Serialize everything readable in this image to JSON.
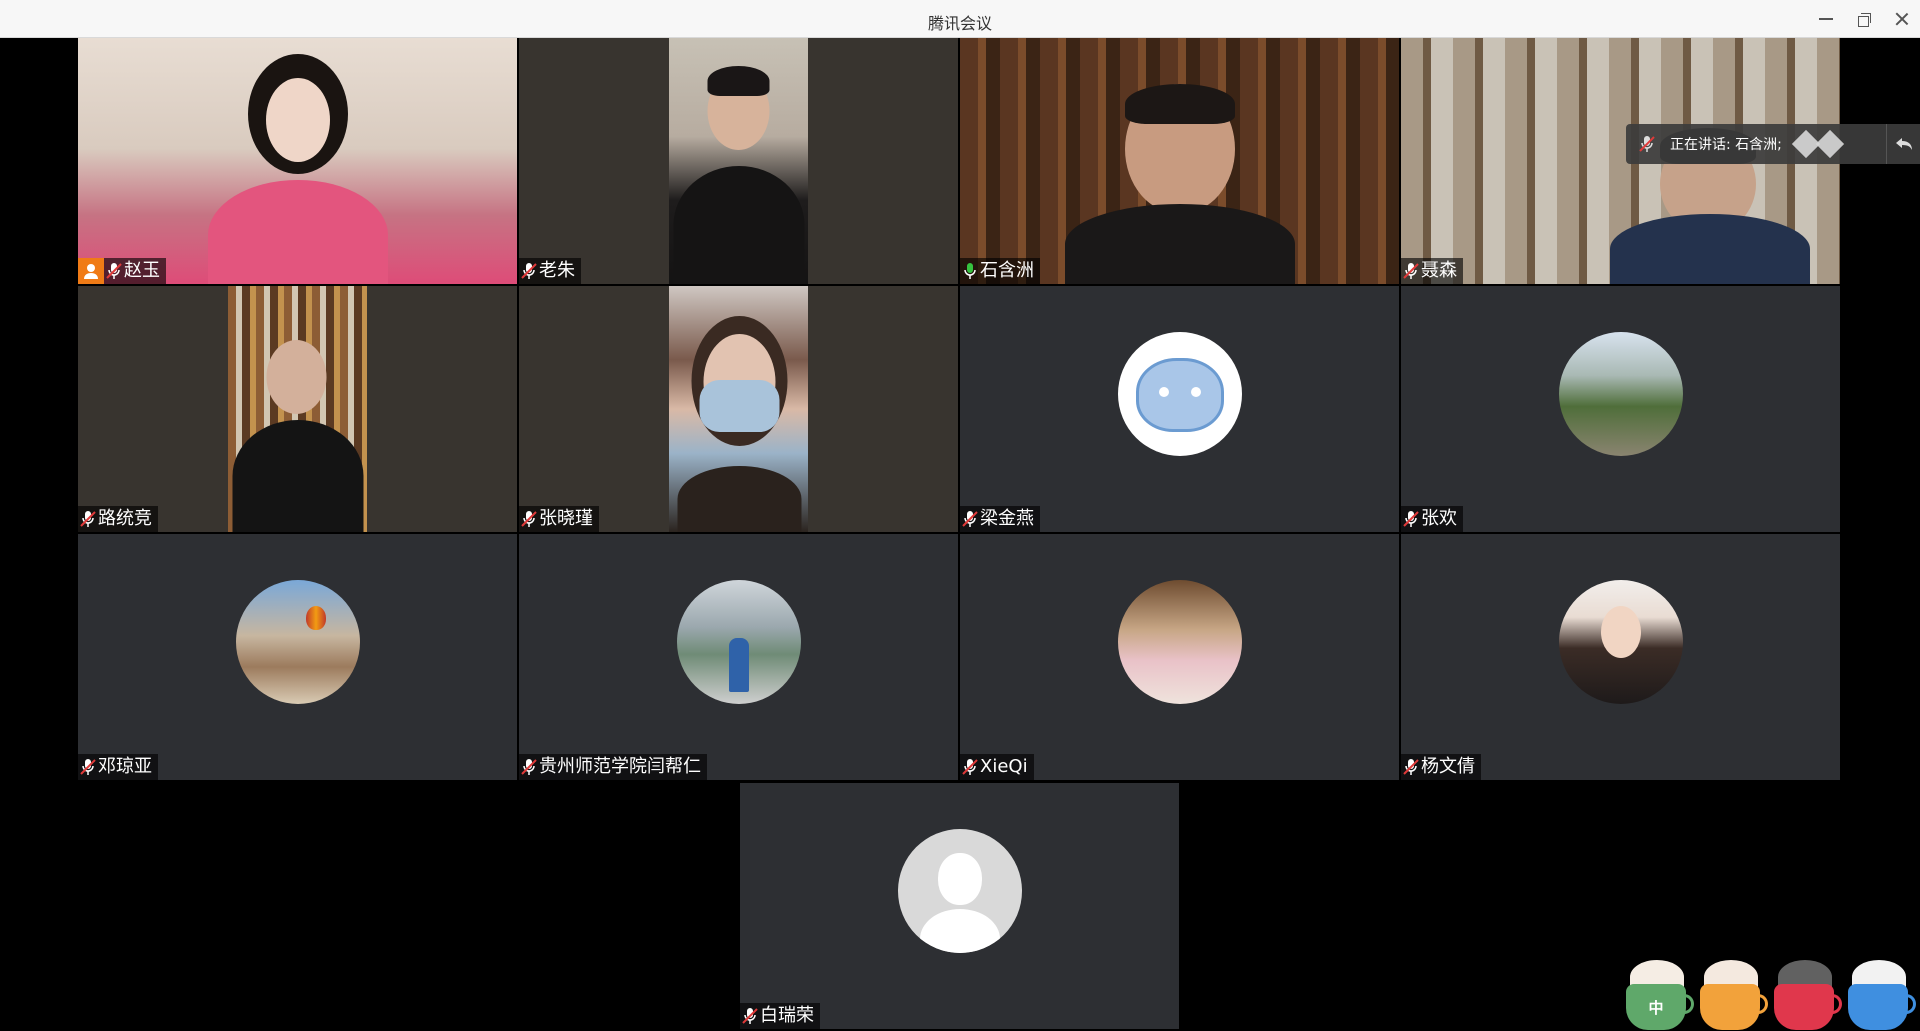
{
  "window": {
    "title": "腾讯会议"
  },
  "speaking": {
    "label": "正在讲话: 石含洲;"
  },
  "participants": [
    {
      "name": "赵玉",
      "host": true,
      "mic": "muted",
      "view": "video",
      "scene": "woman-pink"
    },
    {
      "name": "老朱",
      "host": false,
      "mic": "muted",
      "view": "video",
      "scene": "man-1"
    },
    {
      "name": "石含洲",
      "host": false,
      "mic": "active",
      "view": "video",
      "scene": "shelf",
      "speaking": true
    },
    {
      "name": "聂森",
      "host": false,
      "mic": "muted",
      "view": "video",
      "scene": "study-2"
    },
    {
      "name": "路统竞",
      "host": false,
      "mic": "muted",
      "view": "video",
      "scene": "books-3"
    },
    {
      "name": "张晓瑾",
      "host": false,
      "mic": "muted",
      "view": "video",
      "scene": "mask"
    },
    {
      "name": "梁金燕",
      "host": false,
      "mic": "muted",
      "view": "avatar",
      "avatar": "bear-icon"
    },
    {
      "name": "张欢",
      "host": false,
      "mic": "muted",
      "view": "avatar",
      "avatar": "park-photo"
    },
    {
      "name": "邓琼亚",
      "host": false,
      "mic": "muted",
      "view": "avatar",
      "avatar": "balloon-photo"
    },
    {
      "name": "贵州师范学院闫帮仁",
      "host": false,
      "mic": "muted",
      "view": "avatar",
      "avatar": "lake-photo"
    },
    {
      "name": "XieQi",
      "host": false,
      "mic": "muted",
      "view": "avatar",
      "avatar": "kids-photo"
    },
    {
      "name": "杨文倩",
      "host": false,
      "mic": "muted",
      "view": "avatar",
      "avatar": "girl-photo"
    },
    {
      "name": "白瑞荣",
      "host": false,
      "mic": "muted",
      "view": "avatar",
      "avatar": "default-user-icon"
    }
  ],
  "reactions": [
    {
      "glyph": "中",
      "color": "#5fa86a"
    },
    {
      "glyph": "",
      "color": "#f2a23b"
    },
    {
      "glyph": "",
      "color": "#e0374c"
    },
    {
      "glyph": "",
      "color": "#3f8fe0"
    }
  ],
  "colors": {
    "speaking_border": "#27a82f",
    "host_badge": "#f07b16",
    "tile_bg": "#2d2f33"
  }
}
